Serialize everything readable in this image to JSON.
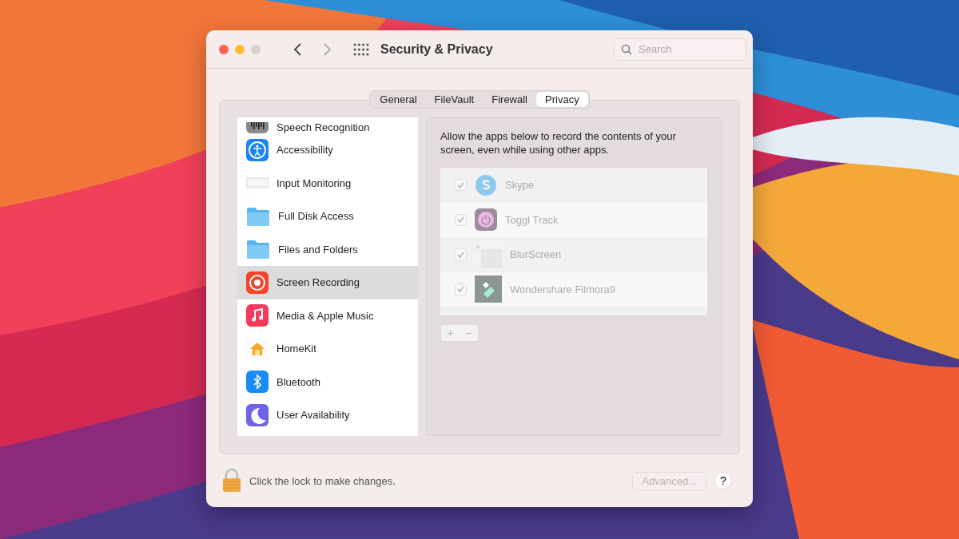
{
  "window": {
    "title": "Security & Privacy"
  },
  "search": {
    "placeholder": "Search"
  },
  "tabs": [
    {
      "label": "General",
      "selected": false
    },
    {
      "label": "FileVault",
      "selected": false
    },
    {
      "label": "Firewall",
      "selected": false
    },
    {
      "label": "Privacy",
      "selected": true
    }
  ],
  "sidebar": {
    "items": [
      {
        "label": "Speech Recognition",
        "kind": "speech",
        "selected": false
      },
      {
        "label": "Accessibility",
        "kind": "accessibility",
        "selected": false
      },
      {
        "label": "Input Monitoring",
        "kind": "keyboard",
        "selected": false
      },
      {
        "label": "Full Disk Access",
        "kind": "folder",
        "selected": false
      },
      {
        "label": "Files and Folders",
        "kind": "folder",
        "selected": false
      },
      {
        "label": "Screen Recording",
        "kind": "record",
        "selected": true
      },
      {
        "label": "Media & Apple Music",
        "kind": "music",
        "selected": false
      },
      {
        "label": "HomeKit",
        "kind": "home",
        "selected": false
      },
      {
        "label": "Bluetooth",
        "kind": "bluetooth",
        "selected": false
      },
      {
        "label": "User Availability",
        "kind": "moon",
        "selected": false
      }
    ]
  },
  "detail": {
    "description": "Allow the apps below to record the contents of your screen, even while using other apps.",
    "disabled": true,
    "apps": [
      {
        "name": "Skype",
        "kind": "skype",
        "checked": true
      },
      {
        "name": "Toggl Track",
        "kind": "toggl",
        "checked": true
      },
      {
        "name": "BlurScreen",
        "kind": "blur",
        "checked": true
      },
      {
        "name": "Wondershare Filmora9",
        "kind": "filmora",
        "checked": true
      }
    ],
    "add_button": "+",
    "remove_button": "−"
  },
  "footer": {
    "lock_text": "Click the lock to make changes.",
    "advanced_button": {
      "label": "Advanced...",
      "disabled": true
    },
    "help_button": "?"
  }
}
